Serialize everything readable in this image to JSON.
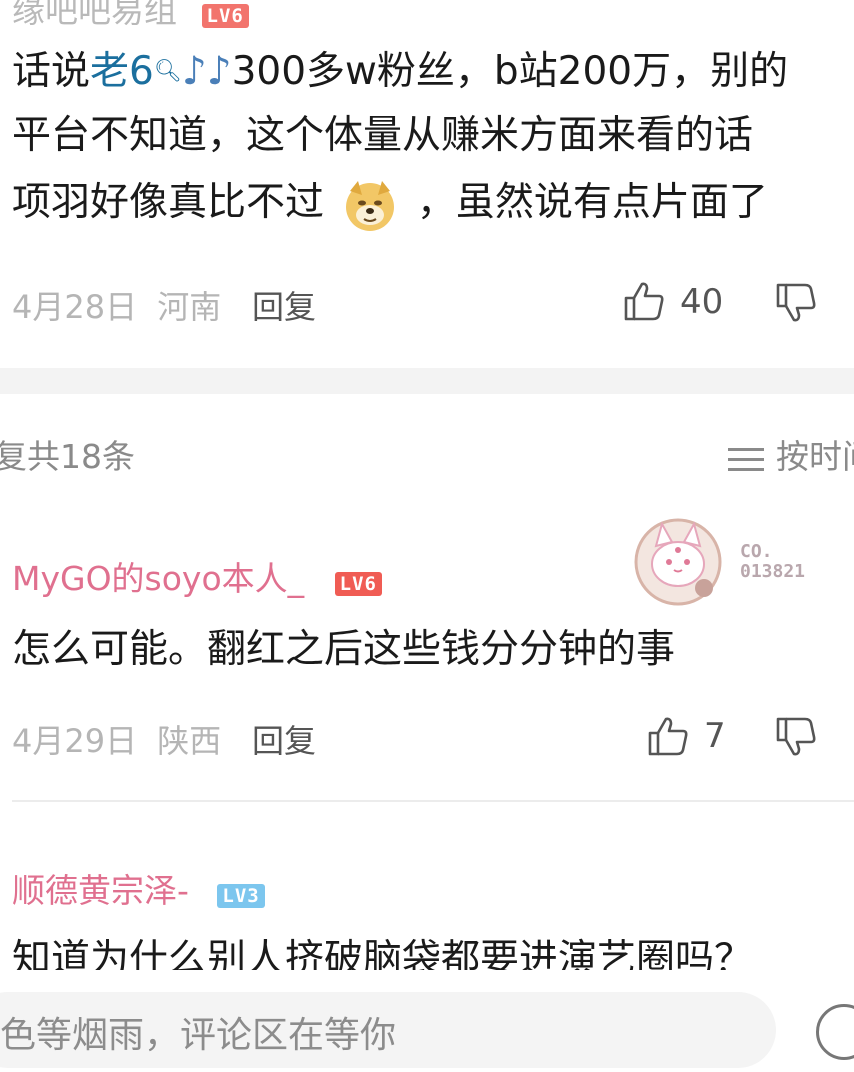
{
  "top_comment": {
    "username": "缘吧吧易组",
    "level": "LV6",
    "text_line1_prefix": "话说",
    "text_line1_link": "老6",
    "text_line1_suffix": "300多w粉丝，b站200万，别的",
    "text_line2": "平台不知道，这个体量从赚米方面来看的话",
    "text_line3_prefix": "项羽好像真比不过",
    "text_line3_suffix": "，虽然说有点片面了",
    "date": "4月28日",
    "location": "河南",
    "reply_label": "回复",
    "like_count": "40"
  },
  "replies_header": {
    "count_label": "复共18条",
    "sort_label": "按时间"
  },
  "reply_1": {
    "username": "MyGO的soyo本人_",
    "level": "LV6",
    "badge_text_1": "CO.",
    "badge_text_2": "013821",
    "text": "怎么可能。翻红之后这些钱分分钟的事",
    "date": "4月29日",
    "location": "陕西",
    "reply_label": "回复",
    "like_count": "7"
  },
  "reply_2": {
    "username": "顺德黄宗泽-",
    "level": "LV3",
    "text": "知道为什么别人挤破脑袋都要进演艺圈吗？"
  },
  "input_bar": {
    "placeholder": "色等烟雨，评论区在等你"
  }
}
